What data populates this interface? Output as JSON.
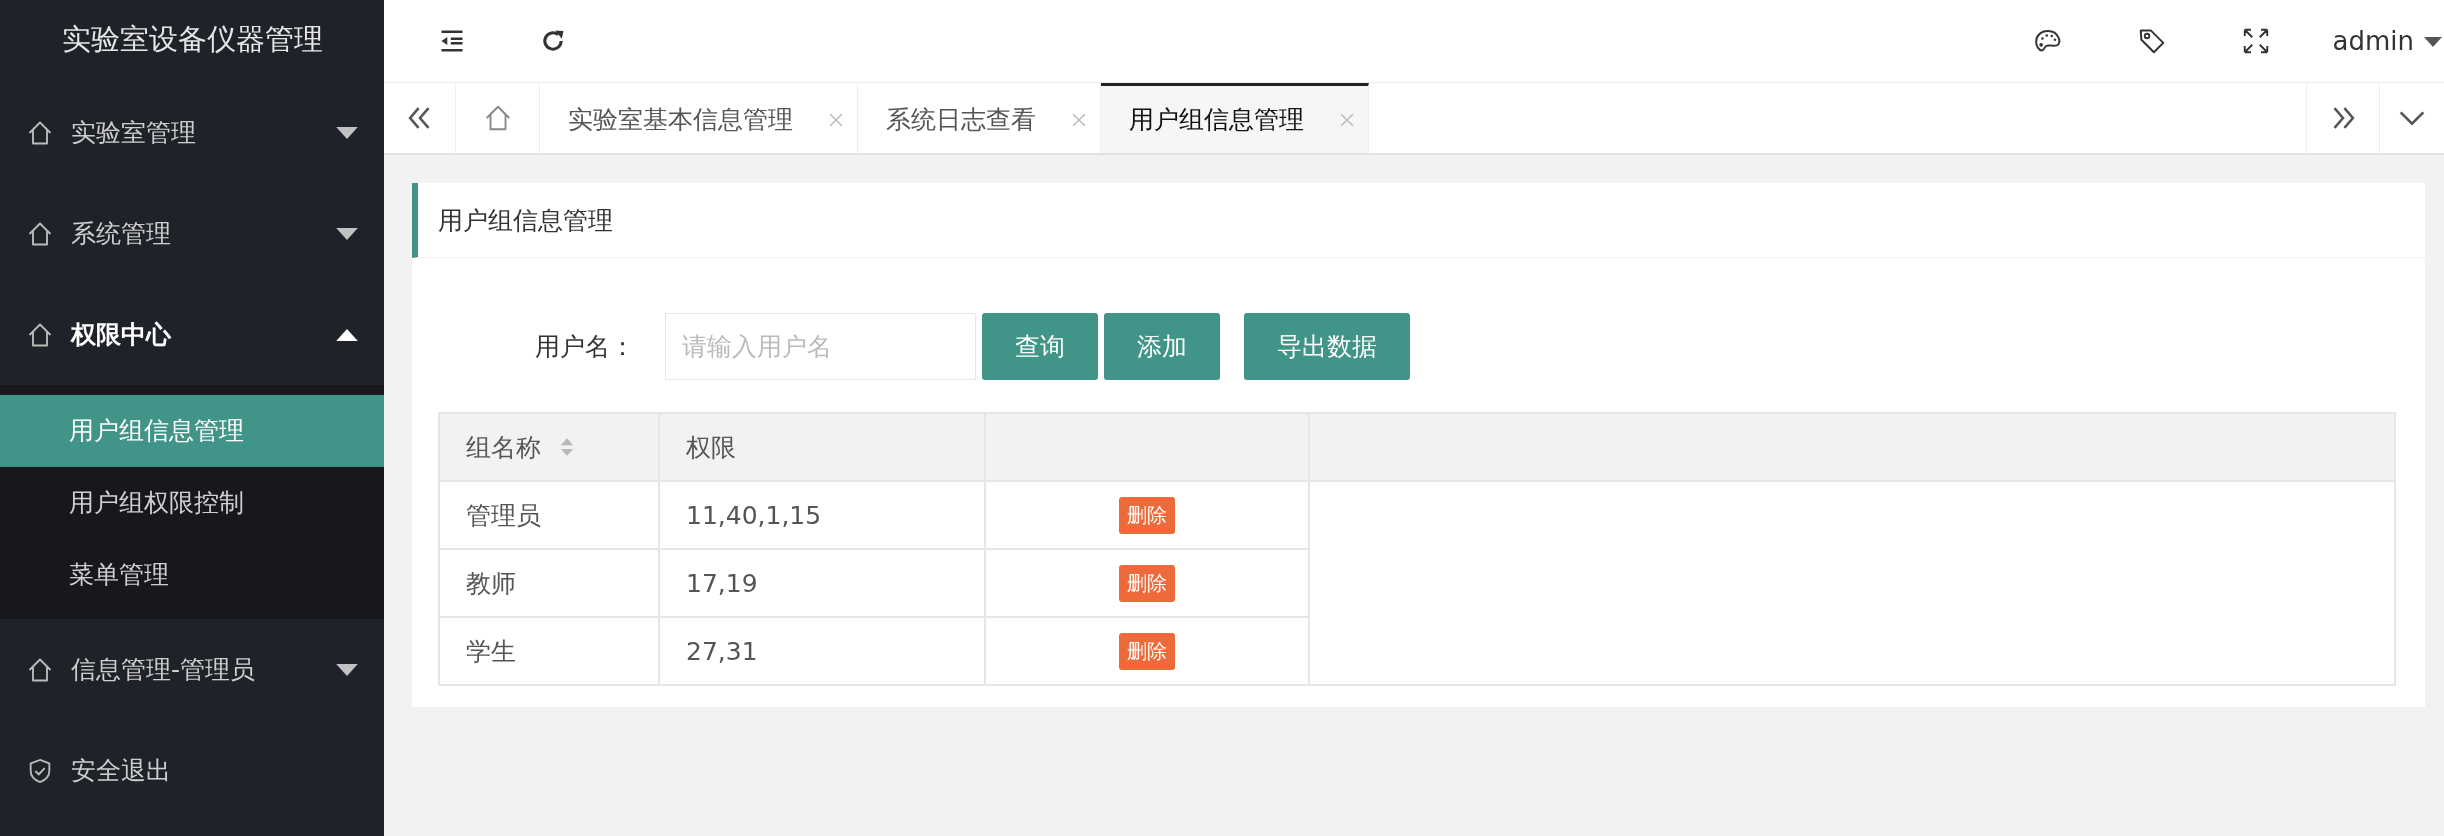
{
  "app_title": "实验室设备仪器管理",
  "sidebar": {
    "items": [
      {
        "kind": "menu",
        "label": "实验室管理",
        "expanded": false
      },
      {
        "kind": "menu",
        "label": "系统管理",
        "expanded": false
      },
      {
        "kind": "menu",
        "label": "权限中心",
        "expanded": true,
        "children": [
          {
            "label": "用户组信息管理",
            "selected": true
          },
          {
            "label": "用户组权限控制",
            "selected": false
          },
          {
            "label": "菜单管理",
            "selected": false
          }
        ]
      },
      {
        "kind": "menu",
        "label": "信息管理-管理员",
        "expanded": false
      },
      {
        "kind": "logout",
        "label": "安全退出"
      }
    ]
  },
  "header": {
    "user": "admin"
  },
  "tabs": [
    {
      "label": "实验室基本信息管理",
      "selected": false
    },
    {
      "label": "系统日志查看",
      "selected": false
    },
    {
      "label": "用户组信息管理",
      "selected": true
    }
  ],
  "panel": {
    "title": "用户组信息管理",
    "search": {
      "label": "用户名：",
      "placeholder": "请输入用户名"
    },
    "buttons": [
      "查询",
      "添加",
      "导出数据"
    ],
    "table": {
      "columns": [
        {
          "label": "组名称",
          "sortable": true
        },
        {
          "label": "权限",
          "sortable": false
        }
      ],
      "rows": [
        {
          "name": "管理员",
          "permissions": "11,40,1,15",
          "action": "删除"
        },
        {
          "name": "教师",
          "permissions": "17,19",
          "action": "删除"
        },
        {
          "name": "学生",
          "permissions": "27,31",
          "action": "删除"
        }
      ]
    }
  }
}
